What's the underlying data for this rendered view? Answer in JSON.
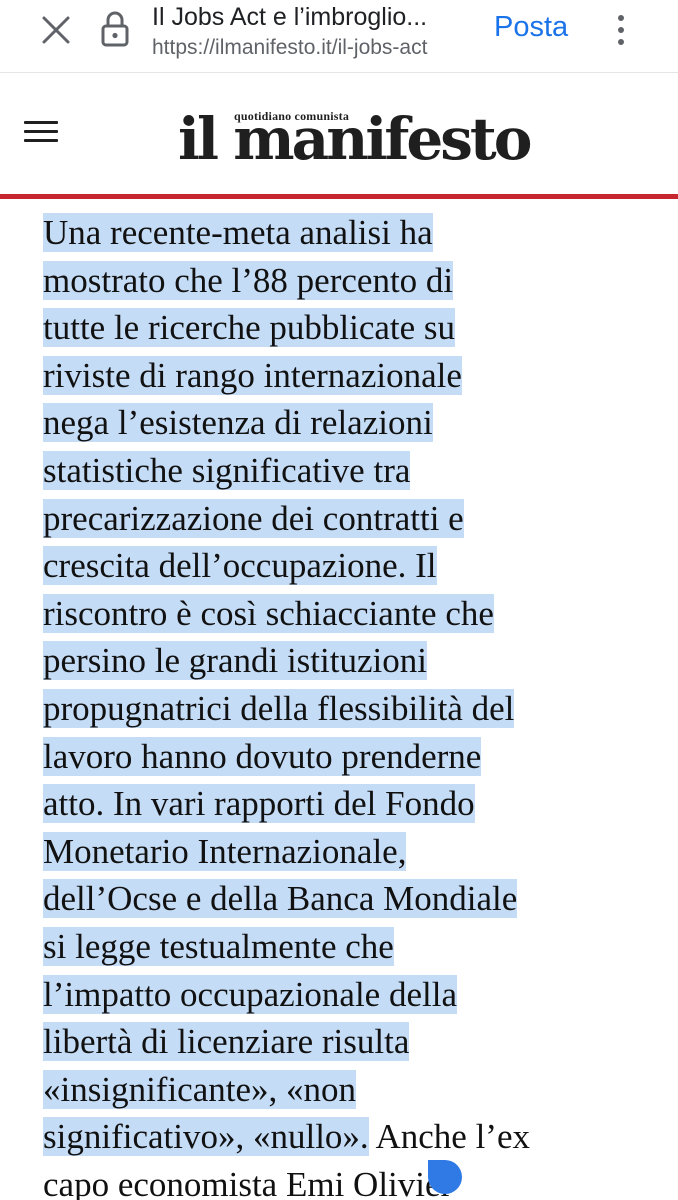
{
  "browser": {
    "page_title": "Il Jobs Act e l’imbroglio...",
    "url": "https://ilmanifesto.it/il-jobs-act",
    "action_label": "Posta",
    "icons": {
      "close": "close-icon",
      "lock": "lock-icon",
      "menu": "more-vert-icon"
    }
  },
  "site": {
    "logo_tagline": "quotidiano comunista",
    "logo_word": "il manifesto",
    "accent_color": "#c6262e",
    "menu_icon": "hamburger-icon"
  },
  "article": {
    "selected_text": "Una recente-meta analisi ha\nmostrato che l’88 percento di\ntutte le ricerche pubblicate su\nriviste di rango internazionale\nnega l’esistenza di relazioni\nstatistiche significative tra\nprecarizzazione dei contratti e\ncrescita dell’occupazione. Il\nriscontro è così schiacciante che\npersino le grandi istituzioni\npropugnatrici della flessibilità del\nlavoro hanno dovuto prenderne\natto. In vari rapporti del Fondo\nMonetario Internazionale,\ndell’Ocse e della Banca Mondiale\nsi legge testualmente che\nl’impatto occupazionale della\nlibertà di licenziare risulta\n«insignificante», «non\nsignificativo», «nullo».",
    "unselected_text": " Anche l’ex\ncapo economista Emi Olivier",
    "selection_color": "#c5dcf6"
  }
}
